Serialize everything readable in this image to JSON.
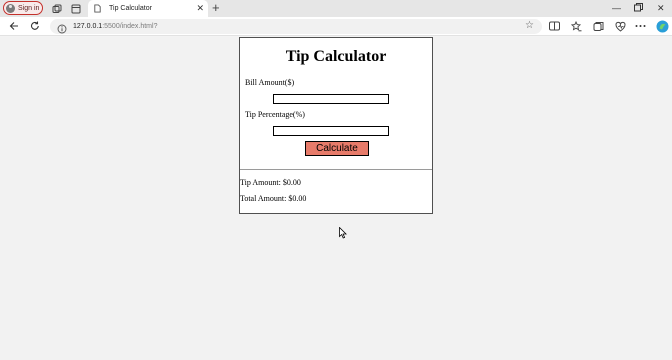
{
  "browser": {
    "signin_label": "Sign in",
    "tab_title": "Tip Calculator",
    "url_host": "127.0.0.1",
    "url_rest": ":5500/index.html?"
  },
  "app": {
    "title": "Tip Calculator",
    "bill_label": "Bill Amount($)",
    "bill_value": "",
    "tip_label": "Tip Percentage(%)",
    "tip_value": "",
    "button_label": "Calculate",
    "tip_amount": "Tip Amount: $0.00",
    "total_amount": "Total Amount: $0.00"
  },
  "colors": {
    "button": "#e77b6a",
    "signin_border": "#c4302b"
  }
}
